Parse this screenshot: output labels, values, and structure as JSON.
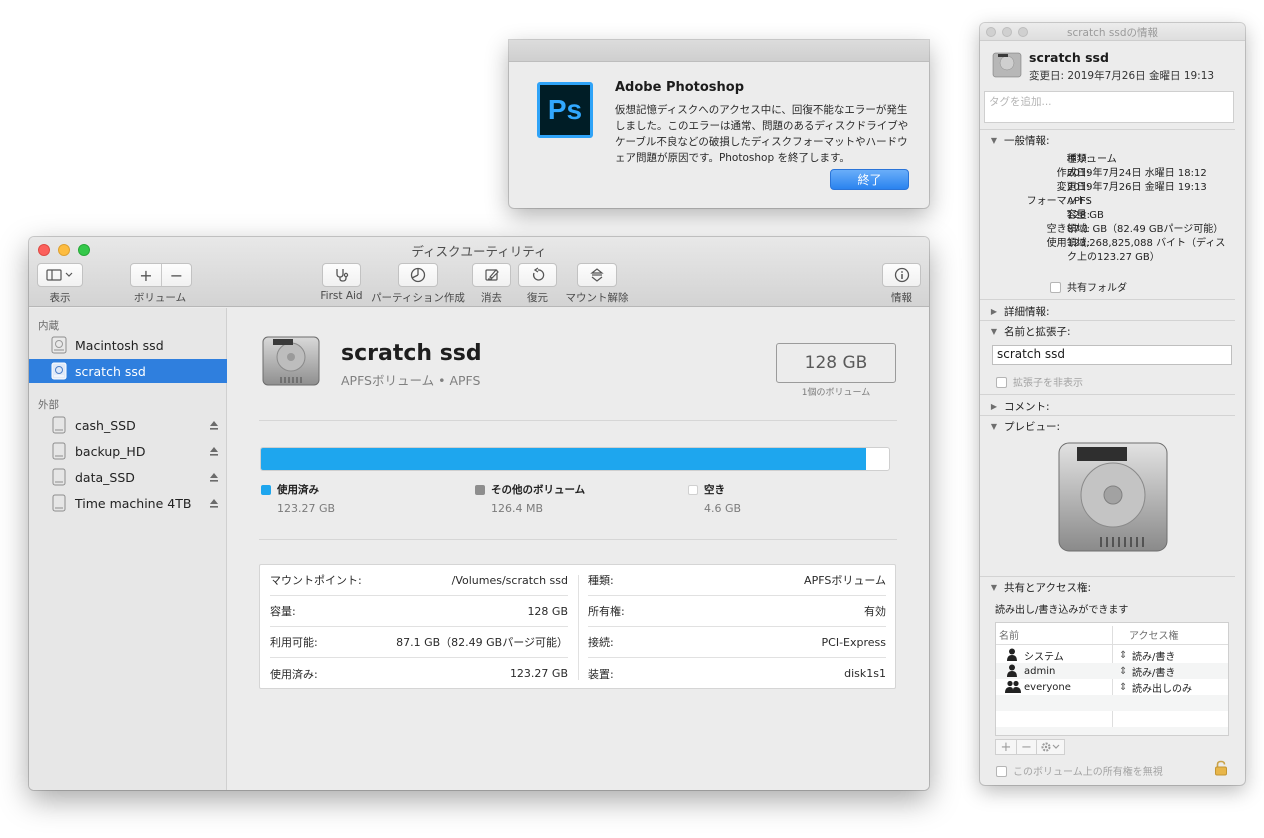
{
  "disk_utility": {
    "title": "ディスクユーティリティ",
    "toolbar": {
      "view_label": "表示",
      "volume_label": "ボリューム",
      "volume_add": "+",
      "volume_remove": "−",
      "first_aid_label": "First Aid",
      "partition_label": "パーティション作成",
      "erase_label": "消去",
      "restore_label": "復元",
      "unmount_label": "マウント解除",
      "info_label": "情報"
    },
    "sidebar": {
      "internal_header": "内蔵",
      "external_header": "外部",
      "internal_items": [
        {
          "label": "Macintosh ssd",
          "selected": false
        },
        {
          "label": "scratch ssd",
          "selected": true
        }
      ],
      "external_items": [
        {
          "label": "cash_SSD"
        },
        {
          "label": "backup_HD"
        },
        {
          "label": "data_SSD"
        },
        {
          "label": "Time machine 4TB"
        }
      ]
    },
    "volume": {
      "name": "scratch ssd",
      "subtitle": "APFSボリューム • APFS",
      "capacity": "128 GB",
      "capacity_sub": "1個のボリューム"
    },
    "usage": {
      "used_fraction": 0.963,
      "colors": {
        "used": "#1ea6ee",
        "other": "#8e8e8e",
        "free": "#ffffff"
      },
      "legend": [
        {
          "label": "使用済み",
          "value": "123.27 GB"
        },
        {
          "label": "その他のボリューム",
          "value": "126.4 MB"
        },
        {
          "label": "空き",
          "value": "4.6 GB"
        }
      ]
    },
    "info_left": [
      {
        "key": "マウントポイント:",
        "value": "/Volumes/scratch ssd"
      },
      {
        "key": "容量:",
        "value": "128 GB"
      },
      {
        "key": "利用可能:",
        "value": "87.1 GB（82.49 GBパージ可能）"
      },
      {
        "key": "使用済み:",
        "value": "123.27 GB"
      }
    ],
    "info_right": [
      {
        "key": "種類:",
        "value": "APFSボリューム"
      },
      {
        "key": "所有権:",
        "value": "有効"
      },
      {
        "key": "接続:",
        "value": "PCI-Express"
      },
      {
        "key": "装置:",
        "value": "disk1s1"
      }
    ]
  },
  "alert": {
    "icon_text": "Ps",
    "title": "Adobe Photoshop",
    "message": "仮想記憶ディスクへのアクセス中に、回復不能なエラーが発生しました。このエラーは通常、問題のあるディスクドライブやケーブル不良などの破損したディスクフォーマットやハードウェア問題が原因です。Photoshop を終了します。",
    "button": "終了"
  },
  "get_info": {
    "title": "scratch ssdの情報",
    "name": "scratch ssd",
    "modified": "変更日: 2019年7月26日 金曜日 19:13",
    "tags_placeholder": "タグを追加...",
    "general_header": "一般情報:",
    "general": [
      {
        "key": "種類:",
        "value": "ボリューム"
      },
      {
        "key": "作成日:",
        "value": "2019年7月24日 水曜日 18:12"
      },
      {
        "key": "変更日:",
        "value": "2019年7月26日 金曜日 19:13"
      },
      {
        "key": "フォーマット:",
        "value": "APFS"
      },
      {
        "key": "容量:",
        "value": "128 GB"
      },
      {
        "key": "空き領域:",
        "value": "87.1 GB（82.49 GBパージ可能）"
      },
      {
        "key": "使用領域:",
        "value": "123,268,825,088 バイト（ディスク上の123.27 GB）"
      }
    ],
    "shared_folder": "共有フォルダ",
    "more_info_header": "詳細情報:",
    "name_ext_header": "名前と拡張子:",
    "name_field": "scratch ssd",
    "hide_ext": "拡張子を非表示",
    "comments_header": "コメント:",
    "preview_header": "プレビュー:",
    "sharing_header": "共有とアクセス権:",
    "sharing_desc": "読み出し/書き込みができます",
    "table_headers": {
      "name": "名前",
      "access": "アクセス権"
    },
    "permissions": [
      {
        "name": "システム",
        "access": "読み/書き"
      },
      {
        "name": "admin",
        "access": "読み/書き"
      },
      {
        "name": "everyone",
        "access": "読み出しのみ"
      }
    ],
    "ignore_ownership": "このボリューム上の所有権を無視"
  }
}
